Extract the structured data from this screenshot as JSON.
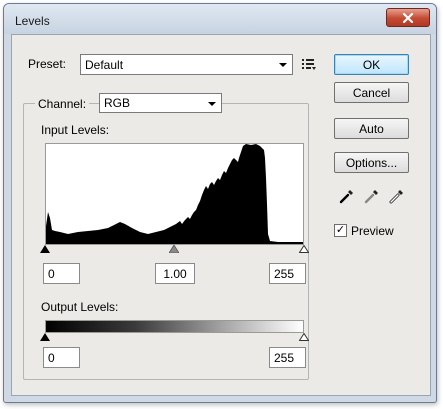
{
  "window": {
    "title": "Levels"
  },
  "preset": {
    "label": "Preset:",
    "value": "Default"
  },
  "channel": {
    "label": "Channel:",
    "value": "RGB"
  },
  "input_levels": {
    "label": "Input Levels:",
    "black": "0",
    "gamma": "1.00",
    "white": "255"
  },
  "output_levels": {
    "label": "Output Levels:",
    "black": "0",
    "white": "255"
  },
  "buttons": {
    "ok": "OK",
    "cancel": "Cancel",
    "auto": "Auto",
    "options": "Options..."
  },
  "preview": {
    "label": "Preview",
    "checked": true
  },
  "icons": {
    "close": "close-icon",
    "preset_options": "preset-options-icon",
    "eyedroppers": [
      "black-eyedropper-icon",
      "gray-eyedropper-icon",
      "white-eyedropper-icon"
    ]
  },
  "colors": {
    "accent": "#3c7fb1",
    "close": "#c44a33"
  }
}
